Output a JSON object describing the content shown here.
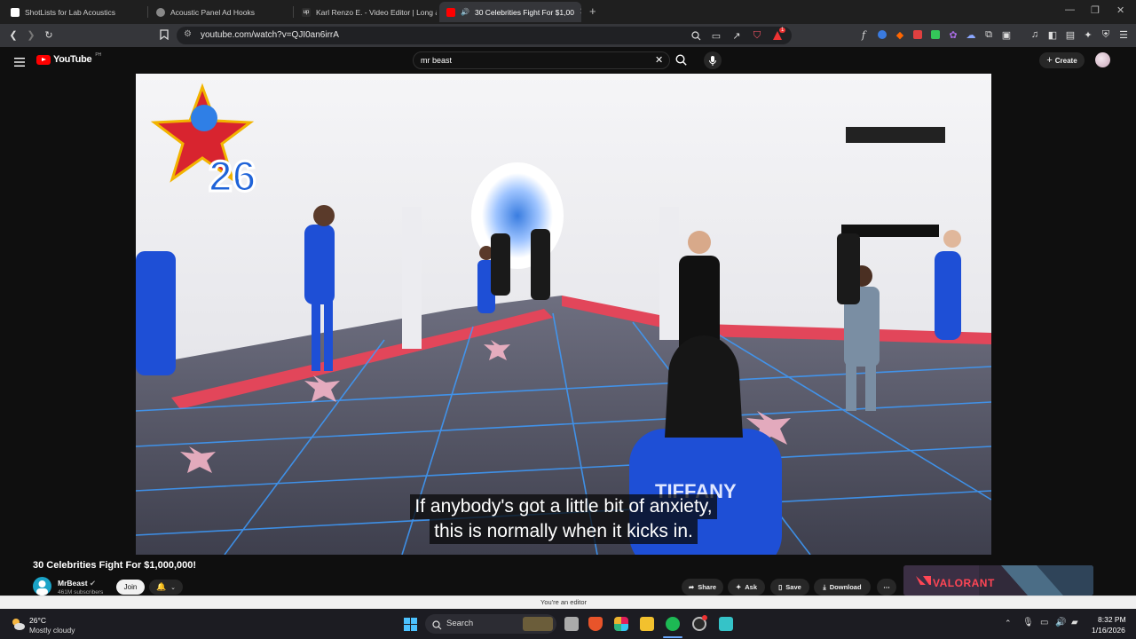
{
  "browser": {
    "tabs": [
      {
        "label": "ShotLists for Lab Acoustics",
        "active": false
      },
      {
        "label": "Acoustic Panel Ad Hooks",
        "active": false
      },
      {
        "label": "Karl Renzo E. - Video Editor | Long &",
        "active": false
      },
      {
        "label": "30 Celebrities Fight For $1,00",
        "active": true
      }
    ],
    "url": "youtube.com/watch?v=QJI0an6irrA",
    "notification_count": "1"
  },
  "youtube": {
    "logo_text": "YouTube",
    "logo_region": "PH",
    "search_query": "mr beast",
    "create_label": "Create",
    "video": {
      "caption_line1": "If anybody's got a little bit of anxiety,",
      "caption_line2": "this is normally when it kicks in.",
      "badge_number": "26",
      "jacket_text": "TIFFANY"
    },
    "title": "30 Celebrities Fight For $1,000,000!",
    "channel": {
      "name": "MrBeast",
      "subscribers": "461M subscribers",
      "join_label": "Join"
    },
    "actions": {
      "share": "Share",
      "ask": "Ask",
      "save": "Save",
      "download": "Download",
      "more": "⋯"
    },
    "ad": {
      "brand": "VALORANT"
    }
  },
  "status_bar": {
    "text": "You're an editor"
  },
  "taskbar": {
    "weather_temp": "26°C",
    "weather_desc": "Mostly cloudy",
    "search_label": "Search",
    "time": "8:32 PM",
    "date": "1/16/2026"
  },
  "colors": {
    "youtube_red": "#ff0000",
    "background": "#0f0f0f",
    "chip": "#272727"
  }
}
